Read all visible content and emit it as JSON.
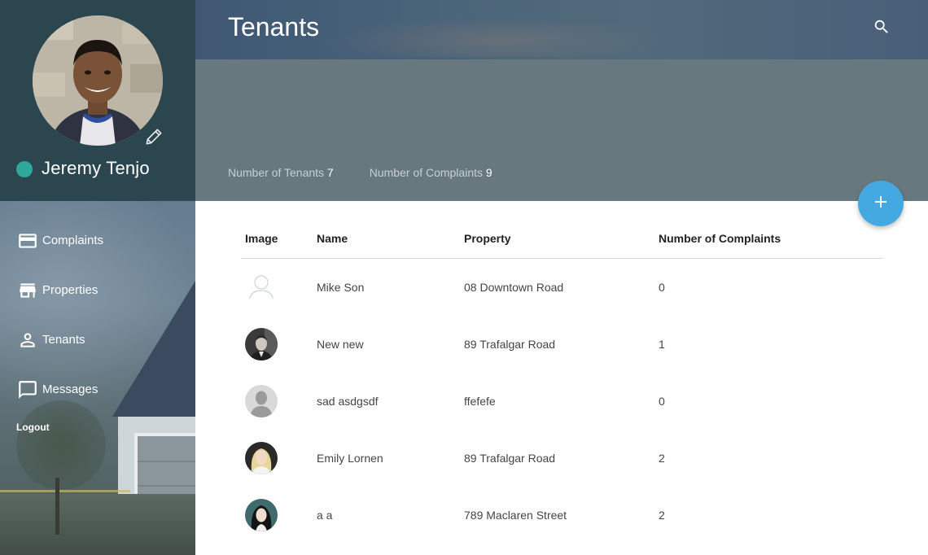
{
  "user": {
    "name": "Jeremy Tenjo",
    "status_color": "#2ea89a"
  },
  "sidebar": {
    "items": [
      {
        "label": "Complaints",
        "icon": "credit-card-icon"
      },
      {
        "label": "Properties",
        "icon": "store-icon"
      },
      {
        "label": "Tenants",
        "icon": "person-icon"
      },
      {
        "label": "Messages",
        "icon": "message-icon"
      }
    ],
    "logout_label": "Logout"
  },
  "header": {
    "title": "Tenants",
    "search_icon": "search-icon",
    "stats": [
      {
        "label": "Number of Tenants",
        "value": "7"
      },
      {
        "label": "Number of Complaints",
        "value": "9"
      }
    ]
  },
  "fab": {
    "icon": "plus-icon",
    "color": "#43a9e0"
  },
  "table": {
    "columns": [
      "Image",
      "Name",
      "Property",
      "Number of Complaints"
    ],
    "rows": [
      {
        "avatar": "placeholder-outline",
        "name": "Mike Son",
        "property": "08 Downtown Road",
        "complaints": "0"
      },
      {
        "avatar": "photo-man-suit",
        "name": "New new",
        "property": "89 Trafalgar Road",
        "complaints": "1"
      },
      {
        "avatar": "placeholder-grey",
        "name": "sad asdgsdf",
        "property": "ffefefe",
        "complaints": "0"
      },
      {
        "avatar": "photo-woman-blonde",
        "name": "Emily Lornen",
        "property": "89 Trafalgar Road",
        "complaints": "2"
      },
      {
        "avatar": "photo-woman-dark",
        "name": "a a",
        "property": "789 Maclaren Street",
        "complaints": "2"
      }
    ]
  }
}
